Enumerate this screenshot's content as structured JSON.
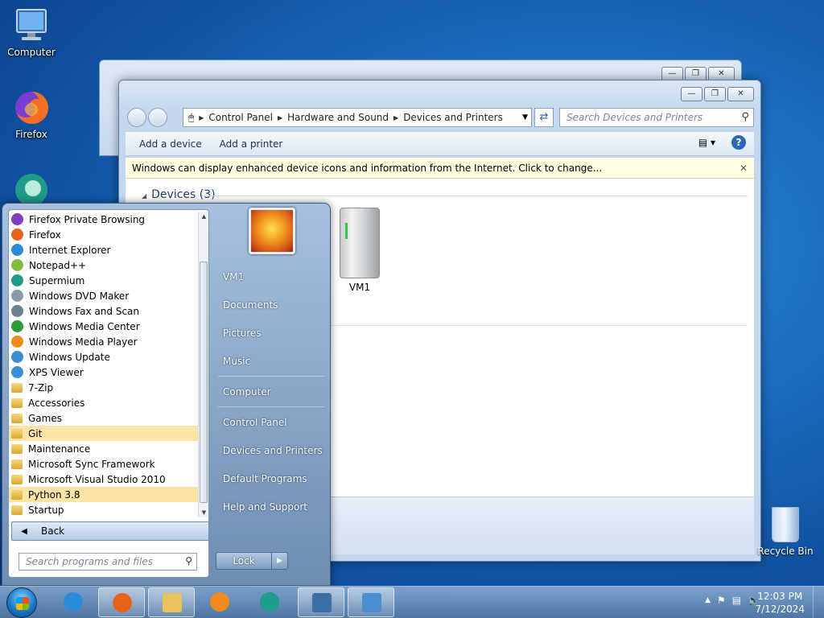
{
  "desktop": {
    "icons": [
      {
        "label": "Computer",
        "icon": "computer-icon"
      },
      {
        "label": "Firefox",
        "icon": "firefox-icon"
      },
      {
        "label": "",
        "icon": "supermium-icon"
      }
    ],
    "recycle_bin": "Recycle Bin"
  },
  "window": {
    "breadcrumb": [
      "Control Panel",
      "Hardware and Sound",
      "Devices and Printers"
    ],
    "search_placeholder": "Search Devices and Printers",
    "commands": [
      "Add a device",
      "Add a printer"
    ],
    "infobar": "Windows can display enhanced device icons and information from the Internet. Click to change...",
    "group_title": "Devices (3)",
    "devices": [
      {
        "name": "VM1",
        "icon": "computer-tower-icon"
      }
    ]
  },
  "start_menu": {
    "programs": [
      {
        "label": "Firefox Private Browsing",
        "icon": "firefox-private-icon",
        "color": "#7b3fbf",
        "folder": false,
        "highlight": false
      },
      {
        "label": "Firefox",
        "icon": "firefox-icon",
        "color": "#e8631a",
        "folder": false,
        "highlight": false
      },
      {
        "label": "Internet Explorer",
        "icon": "ie-icon",
        "color": "#2a8bd8",
        "folder": false,
        "highlight": false
      },
      {
        "label": "Notepad++",
        "icon": "notepadpp-icon",
        "color": "#7fbf3f",
        "folder": false,
        "highlight": false
      },
      {
        "label": "Supermium",
        "icon": "supermium-icon",
        "color": "#1f9c8a",
        "folder": false,
        "highlight": false
      },
      {
        "label": "Windows DVD Maker",
        "icon": "dvd-maker-icon",
        "color": "#8a9aaa",
        "folder": false,
        "highlight": false
      },
      {
        "label": "Windows Fax and Scan",
        "icon": "fax-icon",
        "color": "#6f7f8f",
        "folder": false,
        "highlight": false
      },
      {
        "label": "Windows Media Center",
        "icon": "media-center-icon",
        "color": "#2f9a3a",
        "folder": false,
        "highlight": false
      },
      {
        "label": "Windows Media Player",
        "icon": "media-player-icon",
        "color": "#f08a1c",
        "folder": false,
        "highlight": false
      },
      {
        "label": "Windows Update",
        "icon": "windows-update-icon",
        "color": "#3a8fd0",
        "folder": false,
        "highlight": false
      },
      {
        "label": "XPS Viewer",
        "icon": "xps-viewer-icon",
        "color": "#3b8fd6",
        "folder": false,
        "highlight": false
      },
      {
        "label": "7-Zip",
        "icon": "folder-icon",
        "color": "#e0b040",
        "folder": true,
        "highlight": false
      },
      {
        "label": "Accessories",
        "icon": "folder-icon",
        "color": "#e0b040",
        "folder": true,
        "highlight": false
      },
      {
        "label": "Games",
        "icon": "folder-icon",
        "color": "#e0b040",
        "folder": true,
        "highlight": false
      },
      {
        "label": "Git",
        "icon": "folder-icon",
        "color": "#e0b040",
        "folder": true,
        "highlight": true
      },
      {
        "label": "Maintenance",
        "icon": "folder-icon",
        "color": "#e0b040",
        "folder": true,
        "highlight": false
      },
      {
        "label": "Microsoft Sync Framework",
        "icon": "folder-icon",
        "color": "#e0b040",
        "folder": true,
        "highlight": false
      },
      {
        "label": "Microsoft Visual Studio 2010",
        "icon": "folder-icon",
        "color": "#e0b040",
        "folder": true,
        "highlight": false
      },
      {
        "label": "Python 3.8",
        "icon": "folder-icon",
        "color": "#e0b040",
        "folder": true,
        "highlight": true
      },
      {
        "label": "Startup",
        "icon": "folder-icon",
        "color": "#e0b040",
        "folder": true,
        "highlight": false
      }
    ],
    "back_label": "Back",
    "search_placeholder": "Search programs and files",
    "right_links": [
      "VM1",
      "Documents",
      "Pictures",
      "Music",
      "Computer",
      "Control Panel",
      "Devices and Printers",
      "Default Programs",
      "Help and Support"
    ],
    "lock_label": "Lock"
  },
  "taskbar": {
    "apps": [
      {
        "icon": "ie-icon",
        "active": false,
        "color": "#2a8bd8"
      },
      {
        "icon": "firefox-icon",
        "active": true,
        "color": "#e8631a"
      },
      {
        "icon": "explorer-folder-icon",
        "active": true,
        "color": "#e8c25a"
      },
      {
        "icon": "media-player-icon",
        "active": false,
        "color": "#f08a1c"
      },
      {
        "icon": "supermium-icon",
        "active": false,
        "color": "#1f9c8a"
      },
      {
        "icon": "python-icon",
        "active": true,
        "color": "#3c6fa8"
      },
      {
        "icon": "control-panel-icon",
        "active": true,
        "color": "#4a90d0"
      }
    ],
    "time": "12:03 PM",
    "date": "7/12/2024"
  }
}
